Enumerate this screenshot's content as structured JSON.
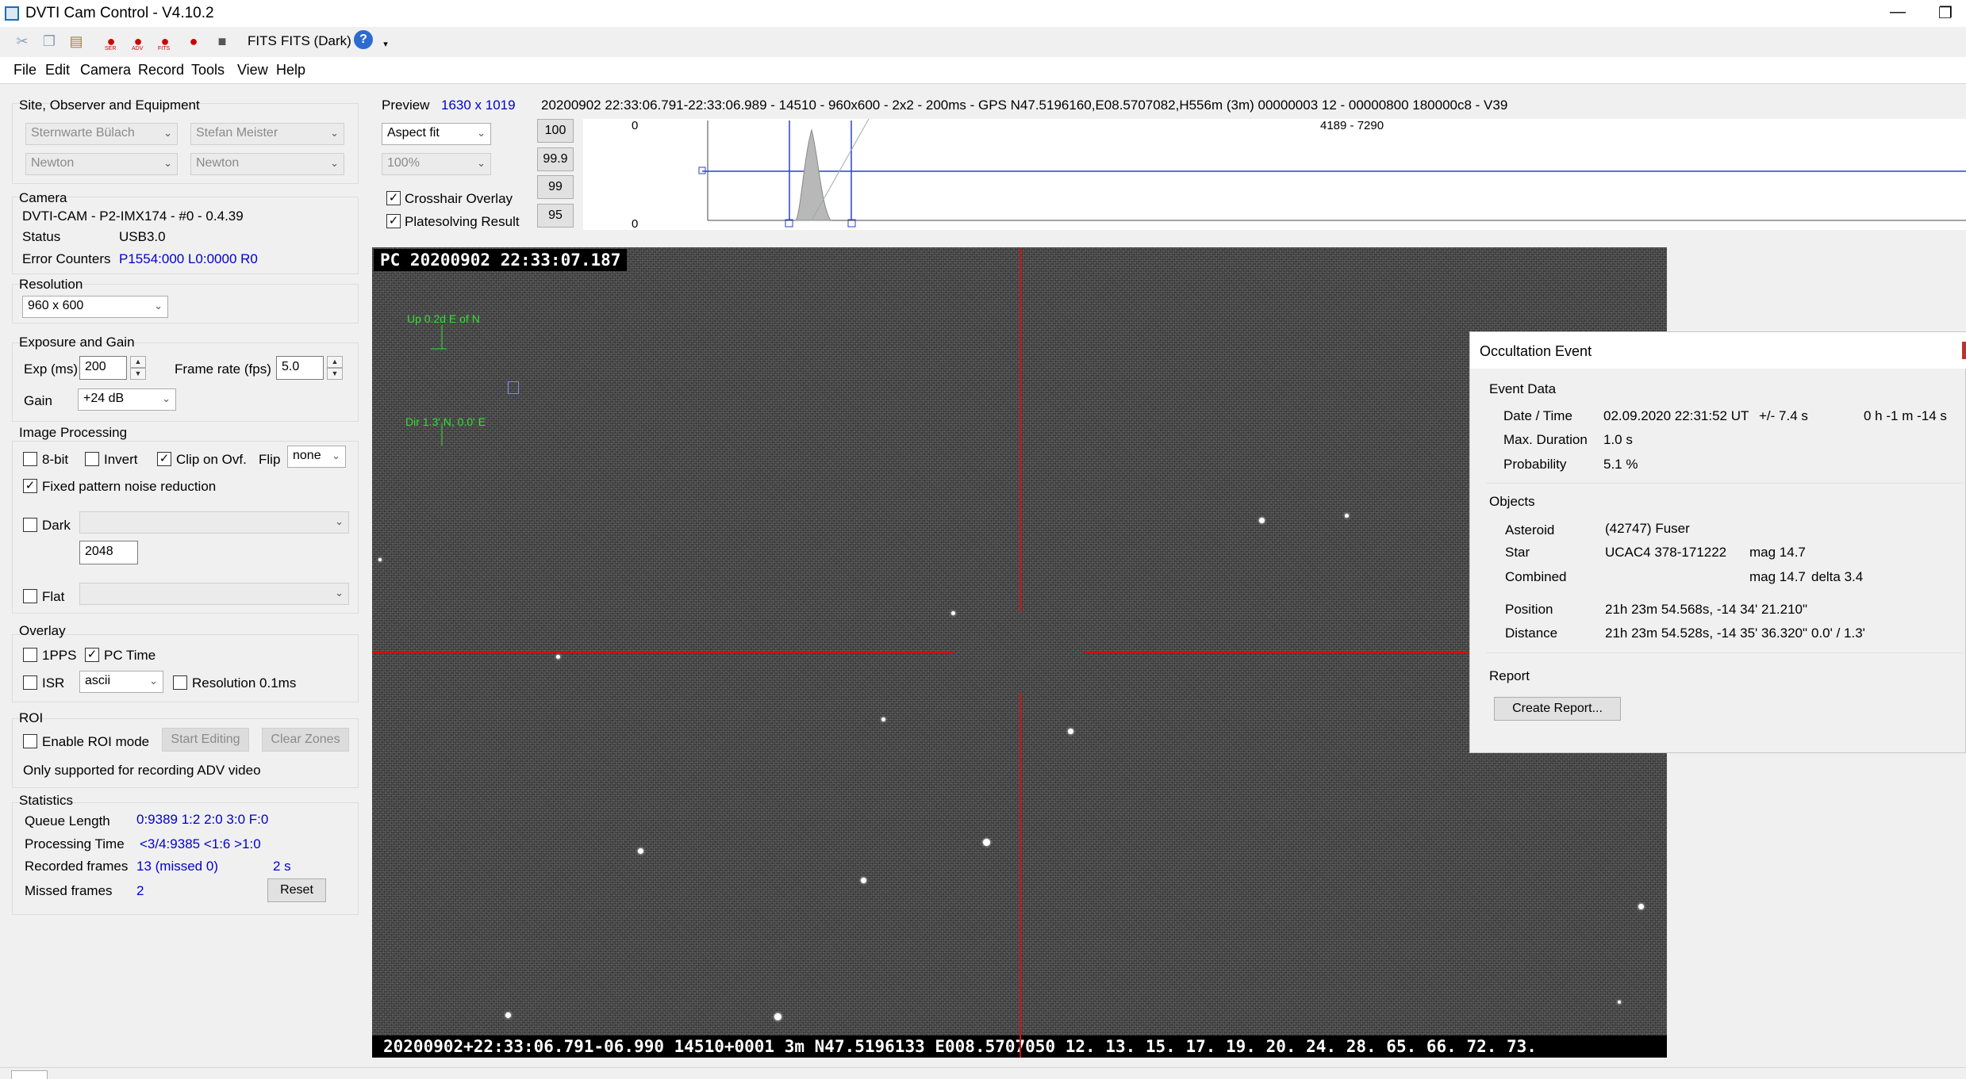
{
  "window": {
    "title": "DVTI Cam Control - V4.10.2",
    "minimize": "—",
    "maximize": "❐"
  },
  "toolbar": {
    "ser": "SER",
    "adv": "ADV",
    "fits_icon": "FITS",
    "fits": "FITS",
    "fits_dark": "FITS (Dark)",
    "help": "?"
  },
  "menu": [
    "File",
    "Edit",
    "Camera",
    "Record",
    "Tools",
    "View",
    "Help"
  ],
  "site": {
    "header": "Site, Observer and Equipment",
    "site": "Sternwarte Bülach",
    "observer": "Stefan Meister",
    "telescope": "Newton",
    "equipment": "Newton"
  },
  "camera": {
    "header": "Camera",
    "model": "DVTI-CAM   -   P2-IMX174   -   #0   -   0.4.39",
    "status_label": "Status",
    "status": "USB3.0",
    "errors_label": "Error Counters",
    "errors": "P1554:000 L0:0000 R0"
  },
  "resolution": {
    "header": "Resolution",
    "value": "960 x 600"
  },
  "exposure": {
    "header": "Exposure and Gain",
    "exp_label": "Exp (ms)",
    "exp": "200",
    "fps_label": "Frame rate (fps)",
    "fps": "5.0",
    "gain_label": "Gain",
    "gain": "+24 dB"
  },
  "processing": {
    "header": "Image Processing",
    "bit8": "8-bit",
    "invert": "Invert",
    "clip": "Clip on Ovf.",
    "flip_label": "Flip",
    "flip": "none",
    "fpn": "Fixed pattern noise reduction",
    "dark": "Dark",
    "dark_value": "2048",
    "flat": "Flat"
  },
  "overlay": {
    "header": "Overlay",
    "pps": "1PPS",
    "pctime": "PC Time",
    "isr": "ISR",
    "isr_mode": "ascii",
    "res": "Resolution 0.1ms"
  },
  "roi": {
    "header": "ROI",
    "enable": "Enable ROI mode",
    "start": "Start Editing",
    "clear": "Clear Zones",
    "note": "Only supported for recording ADV video"
  },
  "stats": {
    "header": "Statistics",
    "queue_label": "Queue Length",
    "queue": "0:9389  1:2  2:0  3:0  F:0",
    "proc_label": "Processing Time",
    "proc": "<3/4:9385 <1:6  >1:0",
    "rec_label": "Recorded frames",
    "rec": "13 (missed 0)",
    "rec_time": "2 s",
    "missed_label": "Missed frames",
    "missed": "2",
    "reset": "Reset"
  },
  "preview": {
    "label": "Preview",
    "size": "1630 x 1019",
    "info": "20200902 22:33:06.791-22:33:06.989 - 14510 - 960x600 - 2x2 - 200ms - GPS N47.5196160,E08.5707082,H556m (3m) 00000003 12 - 00000800 180000c8 - V39",
    "fit": "Aspect fit",
    "zoom": "100%",
    "crosshair": "Crosshair Overlay",
    "plate": "Platesolving Result",
    "levels": [
      "100",
      "99.9",
      "99",
      "95"
    ],
    "hist_top": "0",
    "hist_bottom": "0",
    "hist_range": "4189 - 7290"
  },
  "image": {
    "osd_top": "PC 20200902 22:33:07.187",
    "osd_bottom": "20200902+22:33:06.791-06.990 14510+0001    3m N47.5196133 E008.5707050 12. 13. 15. 17. 19. 20. 24. 28. 65. 66. 72. 73.",
    "up_label": "Up 0.2d E of N",
    "dir_label": "Dir 1.3' N, 0.0' E"
  },
  "occultation": {
    "title": "Occultation Event",
    "event_header": "Event Data",
    "date_label": "Date / Time",
    "date": "02.09.2020 22:31:52 UT",
    "date_err": "+/- 7.4 s",
    "countdown": "0 h -1 m -14 s",
    "dur_label": "Max. Duration",
    "dur": "1.0 s",
    "prob_label": "Probability",
    "prob": "5.1 %",
    "objects_header": "Objects",
    "asteroid_label": "Asteroid",
    "asteroid": "(42747) Fuser",
    "star_label": "Star",
    "star": "UCAC4 378-171222",
    "star_mag": "mag 14.7",
    "comb_label": "Combined",
    "comb_mag": "mag 14.7",
    "comb_delta": "delta 3.4",
    "pos_label": "Position",
    "pos": "21h 23m 54.568s, -14 34' 21.210\"",
    "dist_label": "Distance",
    "dist": "21h 23m 54.528s, -14 35' 36.320\"",
    "dist_val": "0.0' / 1.3'",
    "report_header": "Report",
    "report_btn": "Create Report..."
  }
}
